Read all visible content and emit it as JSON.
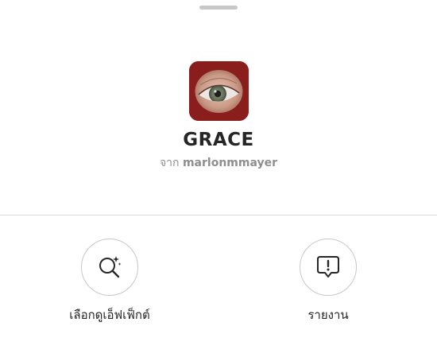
{
  "effect": {
    "name": "GRACE",
    "by_prefix": "จาก",
    "creator": "marlonmmayer",
    "thumbnail_icon": "eye-closeup-icon",
    "thumbnail_bg_color": "#8a1e1c"
  },
  "actions": [
    {
      "label": "เลือกดูเอ็ฟเฟ็กต์",
      "icon": "magnifier-sparkle-icon"
    },
    {
      "label": "รายงาน",
      "icon": "report-alert-icon"
    }
  ],
  "colors": {
    "text_primary": "#262626",
    "text_secondary": "#8e8e8e",
    "border": "#c7c7c7",
    "divider": "#dbdbdb",
    "background": "#ffffff"
  }
}
